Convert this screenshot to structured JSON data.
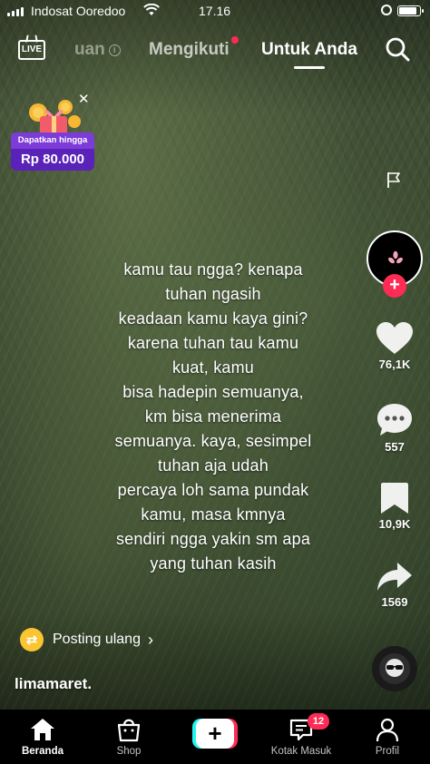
{
  "status_bar": {
    "carrier": "Indosat Ooredoo",
    "time": "17.16"
  },
  "top_nav": {
    "live_label": "LIVE",
    "tab_partial": "uan",
    "tab_following": "Mengikuti",
    "tab_for_you": "Untuk Anda",
    "active_tab": "Untuk Anda"
  },
  "promo": {
    "label": "Dapatkan hingga",
    "amount": "Rp 80.000",
    "close": "✕"
  },
  "caption": {
    "lines": [
      "kamu tau ngga? kenapa",
      "tuhan ngasih",
      "keadaan kamu kaya gini?",
      "karena tuhan tau kamu",
      "kuat, kamu",
      "bisa hadepin semuanya,",
      "km bisa menerima",
      "semuanya. kaya, sesimpel",
      "tuhan aja udah",
      "percaya loh sama pundak",
      "kamu, masa kmnya",
      "sendiri ngga yakin sm apa",
      "yang tuhan kasih"
    ]
  },
  "actions": {
    "likes": "76,1K",
    "comments": "557",
    "bookmarks": "10,9K",
    "shares": "1569"
  },
  "repost": {
    "label": "Posting ulang",
    "chevron": "›"
  },
  "post": {
    "username": "limamaret."
  },
  "bottom_nav": {
    "home": "Beranda",
    "shop": "Shop",
    "create": "+",
    "inbox": "Kotak Masuk",
    "inbox_badge": "12",
    "profile": "Profil"
  },
  "colors": {
    "accent_red": "#fe2c55",
    "accent_cyan": "#25f4ee",
    "promo_purple": "#7d3bd8",
    "repost_yellow": "#fbc531"
  }
}
